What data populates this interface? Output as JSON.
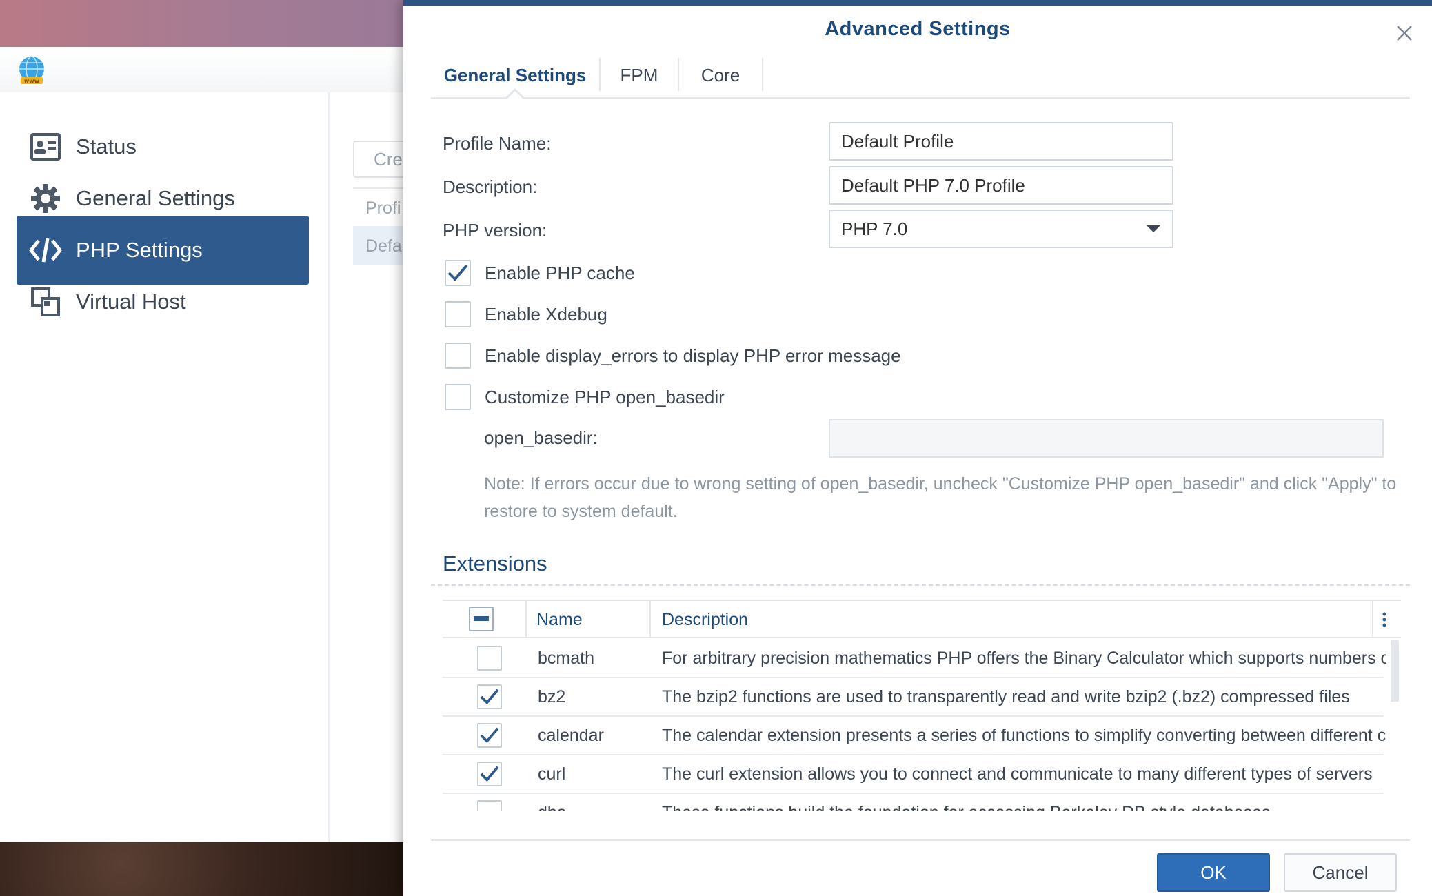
{
  "sidebar": {
    "items": [
      {
        "label": "Status",
        "icon": "status-card-icon"
      },
      {
        "label": "General Settings",
        "icon": "gear-icon"
      },
      {
        "label": "PHP Settings",
        "icon": "code-icon",
        "active": true
      },
      {
        "label": "Virtual Host",
        "icon": "virtual-host-icon"
      }
    ]
  },
  "background_content": {
    "create_button": "Cre",
    "column_header": "Profi",
    "row_value": "Defa"
  },
  "dialog": {
    "title": "Advanced Settings",
    "tabs": [
      {
        "label": "General Settings",
        "active": true
      },
      {
        "label": "FPM"
      },
      {
        "label": "Core"
      }
    ],
    "profile_name": {
      "label": "Profile Name:",
      "value": "Default Profile"
    },
    "description": {
      "label": "Description:",
      "value": "Default PHP 7.0 Profile"
    },
    "php_version": {
      "label": "PHP version:",
      "value": "PHP 7.0"
    },
    "checkboxes": [
      {
        "label": "Enable PHP cache",
        "checked": true
      },
      {
        "label": "Enable Xdebug",
        "checked": false
      },
      {
        "label": "Enable display_errors to display PHP error message",
        "checked": false
      },
      {
        "label": "Customize PHP open_basedir",
        "checked": false
      }
    ],
    "open_basedir": {
      "label": "open_basedir:",
      "value": ""
    },
    "note": "Note: If errors occur due to wrong setting of open_basedir, uncheck \"Customize PHP open_basedir\" and click \"Apply\" to restore to system default.",
    "extensions": {
      "title": "Extensions",
      "columns": {
        "name": "Name",
        "description": "Description"
      },
      "rows": [
        {
          "name": "bcmath",
          "description": "For arbitrary precision mathematics PHP offers the Binary Calculator which supports numbers of any size and precision",
          "checked": false
        },
        {
          "name": "bz2",
          "description": "The bzip2 functions are used to transparently read and write bzip2 (.bz2) compressed files",
          "checked": true
        },
        {
          "name": "calendar",
          "description": "The calendar extension presents a series of functions to simplify converting between different calendar formats",
          "checked": true
        },
        {
          "name": "curl",
          "description": "The curl extension allows you to connect and communicate to many different types of servers",
          "checked": true
        },
        {
          "name": "dba",
          "description": "These functions build the foundation for accessing Berkeley DB style databases",
          "checked": false
        }
      ]
    },
    "buttons": {
      "ok": "OK",
      "cancel": "Cancel"
    }
  },
  "colors": {
    "accent": "#2e5486",
    "primary_button": "#2e6db8",
    "active_nav": "#2f5a8e",
    "title": "#1d4a7b"
  }
}
